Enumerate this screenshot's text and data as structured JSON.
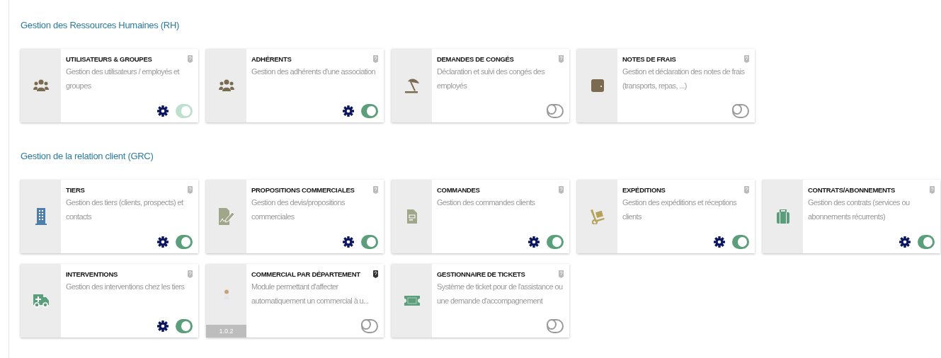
{
  "sections": [
    {
      "title": "Gestion des Ressources Humaines (RH)",
      "modules": [
        {
          "kind": "group",
          "name": "UTILISATEURS & GROUPES",
          "description": "Gestion des utilisateurs / employés et groupes",
          "settings": true,
          "enabled": true,
          "locked": true,
          "help_highlighted": false
        },
        {
          "kind": "group",
          "name": "ADHÉRENTS",
          "description": "Gestion des adhérents d'une association",
          "settings": true,
          "enabled": true,
          "locked": false,
          "help_highlighted": false
        },
        {
          "kind": "umbrella",
          "name": "DEMANDES DE CONGÉS",
          "description": "Déclaration et suivi des congés des employés",
          "settings": false,
          "enabled": false,
          "locked": false,
          "help_highlighted": false
        },
        {
          "kind": "wallet",
          "name": "NOTES DE FRAIS",
          "description": "Gestion et déclaration des notes de frais (transports, repas, ...)",
          "settings": false,
          "enabled": false,
          "locked": false,
          "help_highlighted": false
        }
      ]
    },
    {
      "title": "Gestion de la relation client (GRC)",
      "modules": [
        {
          "kind": "building",
          "name": "TIERS",
          "description": "Gestion des tiers (clients, prospects) et contacts",
          "settings": true,
          "enabled": true,
          "locked": false,
          "help_highlighted": false
        },
        {
          "kind": "signature",
          "name": "PROPOSITIONS COMMERCIALES",
          "description": "Gestion des devis/propositions commerciales",
          "settings": true,
          "enabled": true,
          "locked": false,
          "help_highlighted": false
        },
        {
          "kind": "document",
          "name": "COMMANDES",
          "description": "Gestion des commandes clients",
          "settings": true,
          "enabled": true,
          "locked": false,
          "help_highlighted": false
        },
        {
          "kind": "dolly",
          "name": "EXPÉDITIONS",
          "description": "Gestion des expéditions et réceptions clients",
          "settings": true,
          "enabled": true,
          "locked": false,
          "help_highlighted": false
        },
        {
          "kind": "briefcase",
          "name": "CONTRATS/ABONNEMENTS",
          "description": "Gestion des contrats (services ou abonnements récurrents)",
          "settings": true,
          "enabled": true,
          "locked": false,
          "help_highlighted": false
        },
        {
          "kind": "ambulance",
          "name": "INTERVENTIONS",
          "description": "Gestion des interventions chez les tiers",
          "settings": true,
          "enabled": true,
          "locked": false,
          "help_highlighted": false
        },
        {
          "kind": "person",
          "name": "COMMERCIAL PAR DÉPARTEMENT",
          "description": "Module permettant d'affecter automatiquement un commercial à u...",
          "settings": false,
          "enabled": false,
          "locked": false,
          "help_highlighted": true,
          "version": "1.0.2"
        },
        {
          "kind": "ticket",
          "name": "GESTIONNAIRE DE TICKETS",
          "description": "Système de ticket pour de l'assistance ou une demande d'accompagnement",
          "settings": false,
          "enabled": false,
          "locked": false,
          "help_highlighted": false
        }
      ]
    }
  ]
}
